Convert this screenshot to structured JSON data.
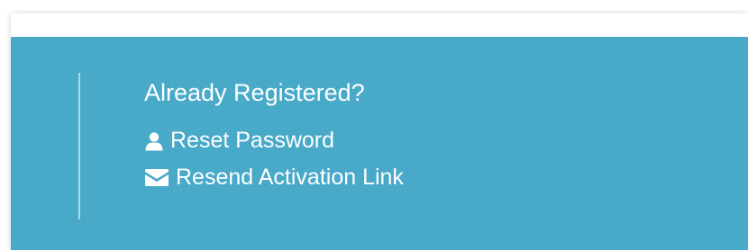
{
  "already_registered": {
    "title": "Already Registered?",
    "links": [
      {
        "label": "Reset Password",
        "icon": "user-icon"
      },
      {
        "label": "Resend Activation Link",
        "icon": "envelope-icon"
      }
    ]
  },
  "colors": {
    "panel_background": "#48a9c9",
    "text": "#ffffff",
    "page_background": "#ffffff"
  }
}
